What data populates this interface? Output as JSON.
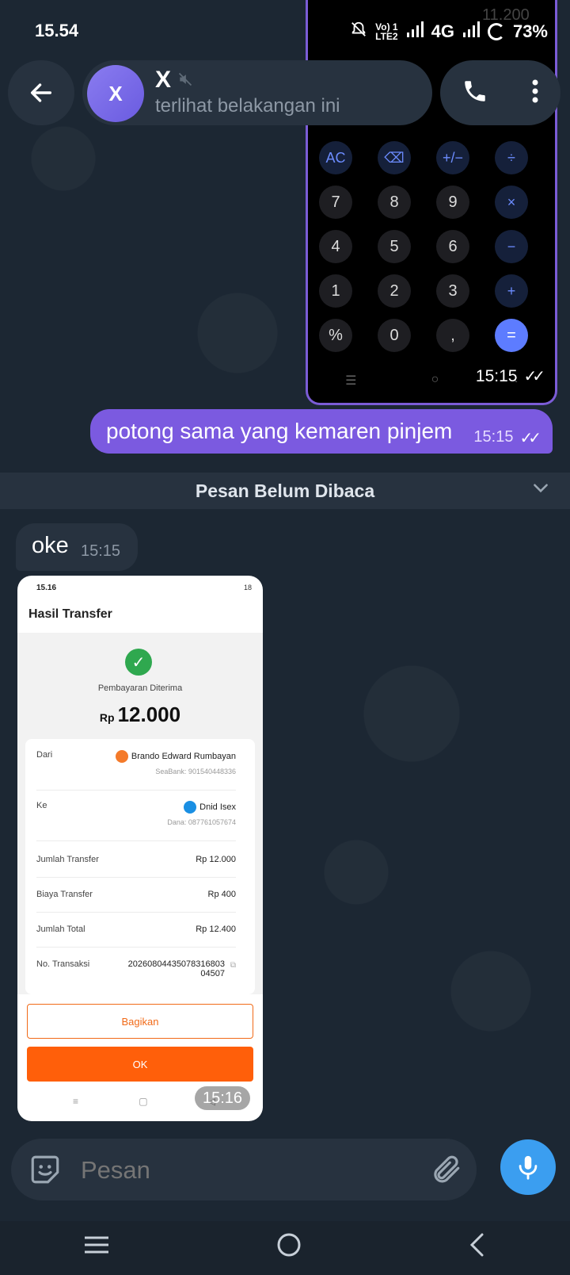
{
  "status_bar": {
    "time": "15.54",
    "network_label": "Vo) 1\nLTE2",
    "network": "4G",
    "battery": "73%"
  },
  "header": {
    "avatar_letter": "X",
    "name": "X",
    "status": "terlihat belakangan ini"
  },
  "calculator": {
    "ghost_value": "11.200",
    "keys": [
      "AC",
      "⌫",
      "+/−",
      "÷",
      "7",
      "8",
      "9",
      "×",
      "4",
      "5",
      "6",
      "−",
      "1",
      "2",
      "3",
      "+",
      "%",
      "0",
      ",",
      "="
    ],
    "time": "15:15"
  },
  "messages": {
    "outgoing_text": "potong sama yang kemaren pinjem",
    "outgoing_time": "15:15",
    "unread_divider": "Pesan Belum Dibaca",
    "incoming_text": "oke",
    "incoming_time": "15:15",
    "screenshot_time": "15:16"
  },
  "transfer": {
    "status_time": "15.16",
    "status_right": "18",
    "title": "Hasil Transfer",
    "paid_label": "Pembayaran Diterima",
    "currency": "Rp",
    "amount": "12.000",
    "from_label": "Dari",
    "from_name": "Brando Edward Rumbayan",
    "from_account": "SeaBank: 901540448336",
    "to_label": "Ke",
    "to_name": "Dnid Isex",
    "to_account": "Dana: 087761057674",
    "transfer_amount_label": "Jumlah Transfer",
    "transfer_amount": "Rp 12.000",
    "fee_label": "Biaya Transfer",
    "fee": "Rp 400",
    "total_label": "Jumlah Total",
    "total": "Rp 12.400",
    "trx_label": "No. Transaksi",
    "trx_line1": "20260804435078316803",
    "trx_line2": "04507",
    "share_button": "Bagikan",
    "ok_button": "OK"
  },
  "composer": {
    "placeholder": "Pesan"
  }
}
